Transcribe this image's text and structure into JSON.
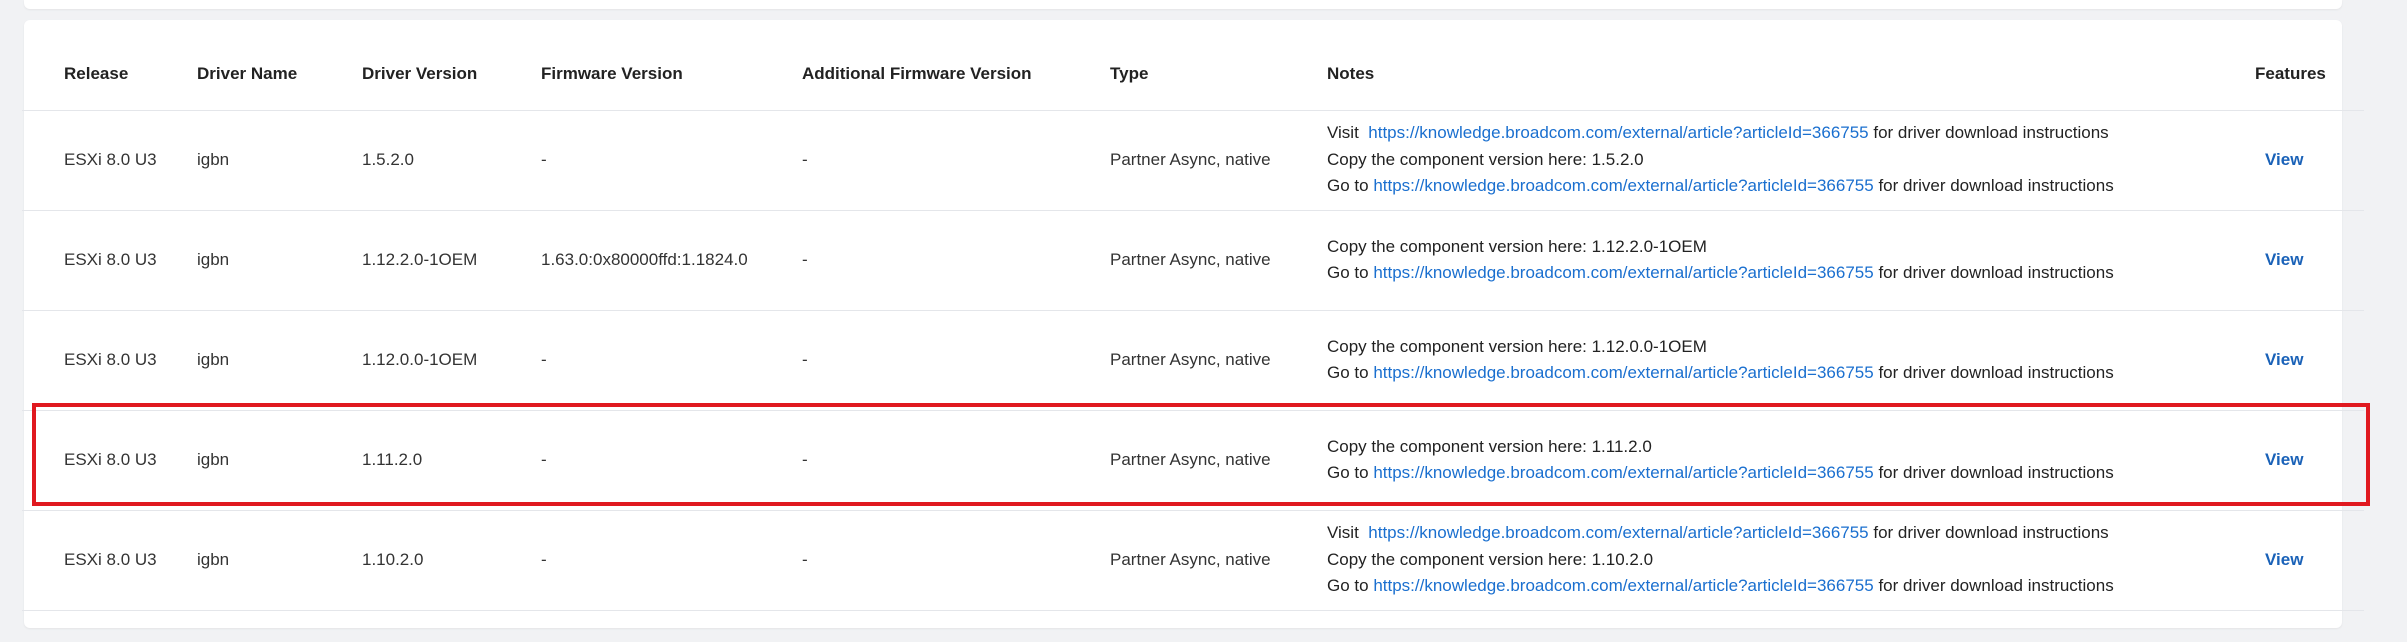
{
  "table": {
    "headers": {
      "release": "Release",
      "driver_name": "Driver Name",
      "driver_version": "Driver Version",
      "firmware_version": "Firmware Version",
      "additional_firmware_version": "Additional Firmware Version",
      "type": "Type",
      "notes": "Notes",
      "features": "Features"
    },
    "rows": [
      {
        "release": "ESXi 8.0 U3",
        "driver_name": "igbn",
        "driver_version": "1.5.2.0",
        "firmware_version": "-",
        "additional_firmware_version": "-",
        "type": "Partner Async, native",
        "notes": {
          "visit_prefix": "Visit",
          "visit_link": "https://knowledge.broadcom.com/external/article?articleId=366755",
          "visit_suffix": "for driver download instructions",
          "copy_text": "Copy the component version here: 1.5.2.0",
          "goto_prefix": "Go to",
          "goto_link": "https://knowledge.broadcom.com/external/article?articleId=366755",
          "goto_suffix": "for driver download instructions"
        },
        "features": "View"
      },
      {
        "release": "ESXi 8.0 U3",
        "driver_name": "igbn",
        "driver_version": "1.12.2.0-1OEM",
        "firmware_version": "1.63.0:0x80000ffd:1.1824.0",
        "additional_firmware_version": "-",
        "type": "Partner Async, native",
        "notes": {
          "copy_text": "Copy the component version here: 1.12.2.0-1OEM",
          "goto_prefix": "Go to",
          "goto_link": "https://knowledge.broadcom.com/external/article?articleId=366755",
          "goto_suffix": "for driver download instructions"
        },
        "features": "View"
      },
      {
        "release": "ESXi 8.0 U3",
        "driver_name": "igbn",
        "driver_version": "1.12.0.0-1OEM",
        "firmware_version": "-",
        "additional_firmware_version": "-",
        "type": "Partner Async, native",
        "notes": {
          "copy_text": "Copy the component version here: 1.12.0.0-1OEM",
          "goto_prefix": "Go to",
          "goto_link": "https://knowledge.broadcom.com/external/article?articleId=366755",
          "goto_suffix": "for driver download instructions"
        },
        "features": "View"
      },
      {
        "release": "ESXi 8.0 U3",
        "driver_name": "igbn",
        "driver_version": "1.11.2.0",
        "firmware_version": "-",
        "additional_firmware_version": "-",
        "type": "Partner Async, native",
        "notes": {
          "copy_text": "Copy the component version here: 1.11.2.0",
          "goto_prefix": "Go to",
          "goto_link": "https://knowledge.broadcom.com/external/article?articleId=366755",
          "goto_suffix": "for driver download instructions"
        },
        "features": "View"
      },
      {
        "release": "ESXi 8.0 U3",
        "driver_name": "igbn",
        "driver_version": "1.10.2.0",
        "firmware_version": "-",
        "additional_firmware_version": "-",
        "type": "Partner Async, native",
        "notes": {
          "visit_prefix": "Visit",
          "visit_link": "https://knowledge.broadcom.com/external/article?articleId=366755",
          "visit_suffix": "for driver download instructions",
          "copy_text": "Copy the component version here: 1.10.2.0",
          "goto_prefix": "Go to",
          "goto_link": "https://knowledge.broadcom.com/external/article?articleId=366755",
          "goto_suffix": "for driver download instructions"
        },
        "features": "View"
      }
    ]
  },
  "colors": {
    "link": "#1a6fcf",
    "view_link": "#1a62b8",
    "highlight_border": "#e0191f",
    "row_divider": "#e4e6ea"
  }
}
